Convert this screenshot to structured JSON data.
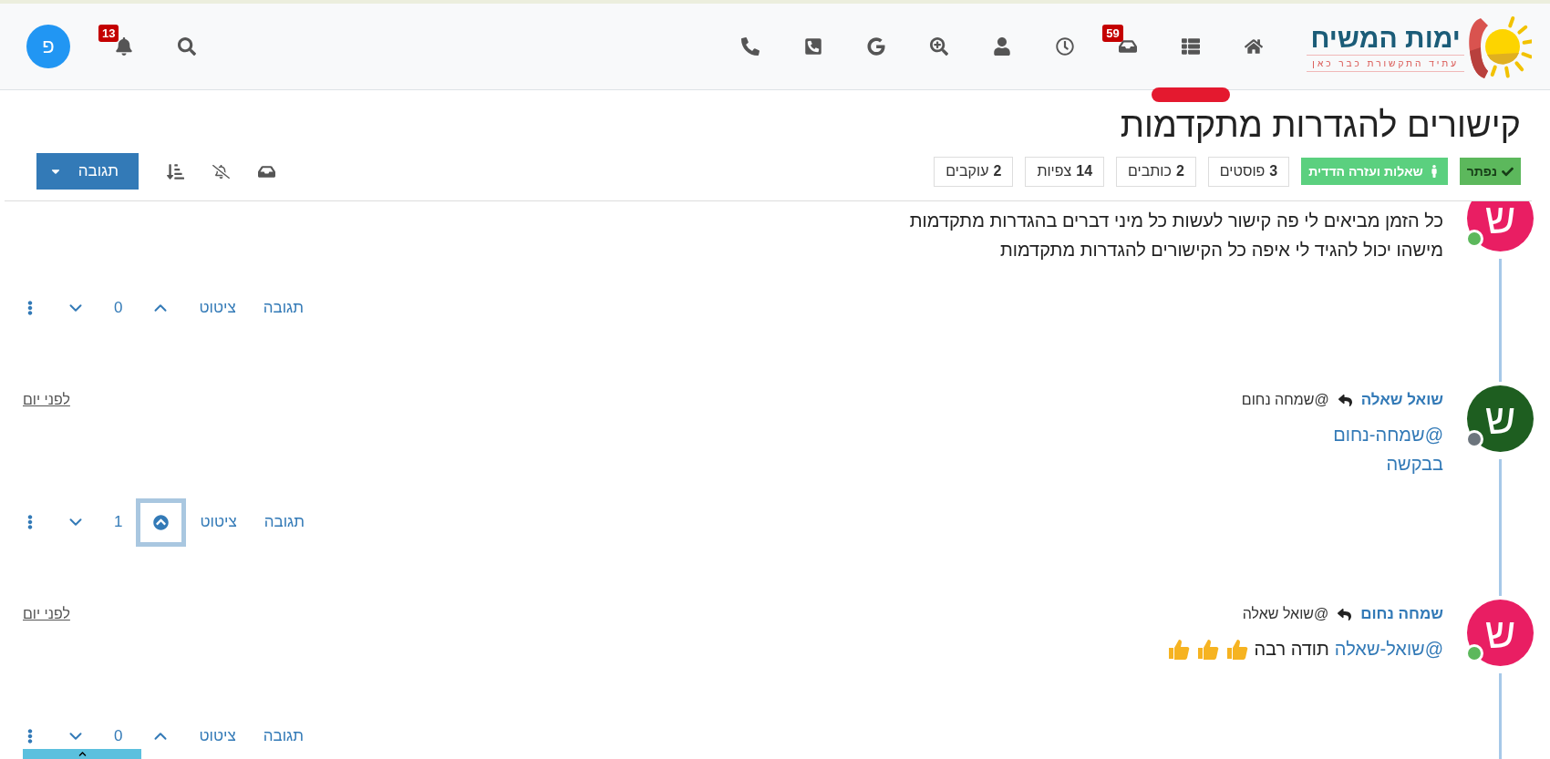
{
  "nav": {
    "logo": {
      "title": "ימות המשיח",
      "tagline": "עתיד התקשורת כבר כאן"
    },
    "items": [
      {
        "kind": "home",
        "selected": false
      },
      {
        "kind": "list",
        "selected": true
      },
      {
        "kind": "inbox",
        "selected": false,
        "badge": "59"
      },
      {
        "kind": "clock",
        "selected": false
      },
      {
        "kind": "user",
        "selected": false
      },
      {
        "kind": "zoom",
        "selected": false
      },
      {
        "kind": "google",
        "selected": false
      },
      {
        "kind": "phone_square",
        "selected": false
      },
      {
        "kind": "phone",
        "selected": false
      }
    ],
    "tools": [
      {
        "kind": "search"
      },
      {
        "kind": "notifications",
        "badge": "13"
      }
    ],
    "account": {
      "letter": "פ"
    }
  },
  "topic": {
    "title": "קישורים להגדרות מתקדמות",
    "labels": [
      {
        "kind": "solved",
        "text": "נפתר"
      },
      {
        "kind": "category",
        "text": "שאלות ועזרה הדדית"
      }
    ],
    "stats": [
      {
        "count": "3",
        "label": "פוסטים"
      },
      {
        "count": "2",
        "label": "כותבים"
      },
      {
        "count": "14",
        "label": "צפיות"
      },
      {
        "count": "2",
        "label": "עוקבים"
      }
    ],
    "tools": [
      {
        "kind": "inbox"
      },
      {
        "kind": "mute"
      },
      {
        "kind": "sort"
      }
    ],
    "reply_button": "תגובה"
  },
  "posts": [
    {
      "avatar": {
        "letter": "ש",
        "color": "#e91e63"
      },
      "online": true,
      "body": [
        [
          {
            "kind": "text",
            "text": "כל הזמן מביאים לי פה קישור לעשות כל מיני דברים בהגדרות מתקדמות"
          }
        ],
        [
          {
            "kind": "text",
            "text": "מישהו יכול להגיד לי איפה כל הקישורים להגדרות מתקדמות"
          }
        ]
      ],
      "actions": [
        "תגובה",
        "ציטוט"
      ],
      "votes": "0",
      "upvoted": false
    },
    {
      "avatar": {
        "letter": "ש",
        "color": "#1e5e20"
      },
      "online": false,
      "author": "שואל שאלה",
      "reply_to": "@שמחה נחום",
      "time": "לפני יום",
      "body": [
        [
          {
            "kind": "mention",
            "text": "@שמחה-נחום"
          }
        ],
        [
          {
            "kind": "link",
            "text": "בבקשה"
          }
        ]
      ],
      "actions": [
        "תגובה",
        "ציטוט"
      ],
      "votes": "1",
      "upvoted": true
    },
    {
      "avatar": {
        "letter": "ש",
        "color": "#e91e63"
      },
      "online": true,
      "author": "שמחה נחום",
      "reply_to": "@שואל שאלה",
      "time": "לפני יום",
      "body": [
        [
          {
            "kind": "mention",
            "text": "@שואל-שאלה"
          },
          {
            "kind": "text",
            "text": "תודה רבה"
          },
          {
            "kind": "thumbs_up"
          },
          {
            "kind": "thumbs_up"
          },
          {
            "kind": "thumbs_up"
          }
        ]
      ],
      "actions": [
        "תגובה",
        "ציטוט"
      ],
      "votes": "0",
      "upvoted": false
    }
  ]
}
